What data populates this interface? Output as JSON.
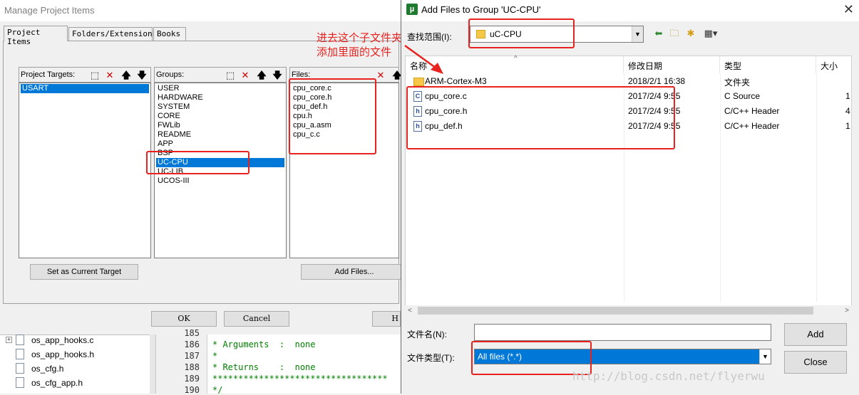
{
  "manage_window": {
    "title": "Manage Project Items",
    "tabs": [
      "Project Items",
      "Folders/Extensions",
      "Books"
    ],
    "targets_label": "Project Targets:",
    "targets": [
      "USART"
    ],
    "groups_label": "Groups:",
    "groups": [
      "USER",
      "HARDWARE",
      "SYSTEM",
      "CORE",
      "FWLib",
      "README",
      "APP",
      "BSP",
      "UC-CPU",
      "UC-LIB",
      "UCOS-III"
    ],
    "selected_group": "UC-CPU",
    "files_label": "Files:",
    "files": [
      "cpu_core.c",
      "cpu_core.h",
      "cpu_def.h",
      "cpu.h",
      "cpu_a.asm",
      "cpu_c.c"
    ],
    "set_target_button": "Set as Current Target",
    "add_files_button": "Add Files...",
    "ok_button": "OK",
    "cancel_button": "Cancel",
    "help_button_partial": "H"
  },
  "annotation": {
    "line1": "进去这个子文件夹",
    "line2": "添加里面的文件"
  },
  "editor": {
    "tree_files": [
      "os_app_hooks.c",
      "os_app_hooks.h",
      "os_cfg.h",
      "os_cfg_app.h"
    ],
    "line_numbers": [
      "185",
      "186",
      "187",
      "188",
      "189",
      "190"
    ],
    "code_lines": [
      "",
      "* Arguments  :  none",
      "*",
      "* Returns    :  none",
      "**********************************",
      "*/"
    ]
  },
  "dialog": {
    "title": "Add Files to Group 'UC-CPU'",
    "look_in_label": "查找范围(I):",
    "look_in_value": "uC-CPU",
    "columns": [
      "名称",
      "修改日期",
      "类型",
      "大小"
    ],
    "rows": [
      {
        "icon": "folder-icon",
        "name": "ARM-Cortex-M3",
        "date": "2018/2/1 16:38",
        "type": "文件夹",
        "size": ""
      },
      {
        "icon": "c-file-icon",
        "name": "cpu_core.c",
        "date": "2017/2/4 9:55",
        "type": "C Source",
        "size": "1"
      },
      {
        "icon": "h-file-icon",
        "name": "cpu_core.h",
        "date": "2017/2/4 9:55",
        "type": "C/C++ Header",
        "size": "4"
      },
      {
        "icon": "h-file-icon",
        "name": "cpu_def.h",
        "date": "2017/2/4 9:55",
        "type": "C/C++ Header",
        "size": "1"
      }
    ],
    "file_name_label": "文件名(N):",
    "file_name_value": "",
    "file_type_label": "文件类型(T):",
    "file_type_value": "All files (*.*)",
    "add_button": "Add",
    "close_button": "Close"
  },
  "watermark": "http://blog.csdn.net/flyerwu",
  "colors": {
    "selection": "#0078d7",
    "annotation": "#e8231f",
    "comment": "#008000"
  }
}
